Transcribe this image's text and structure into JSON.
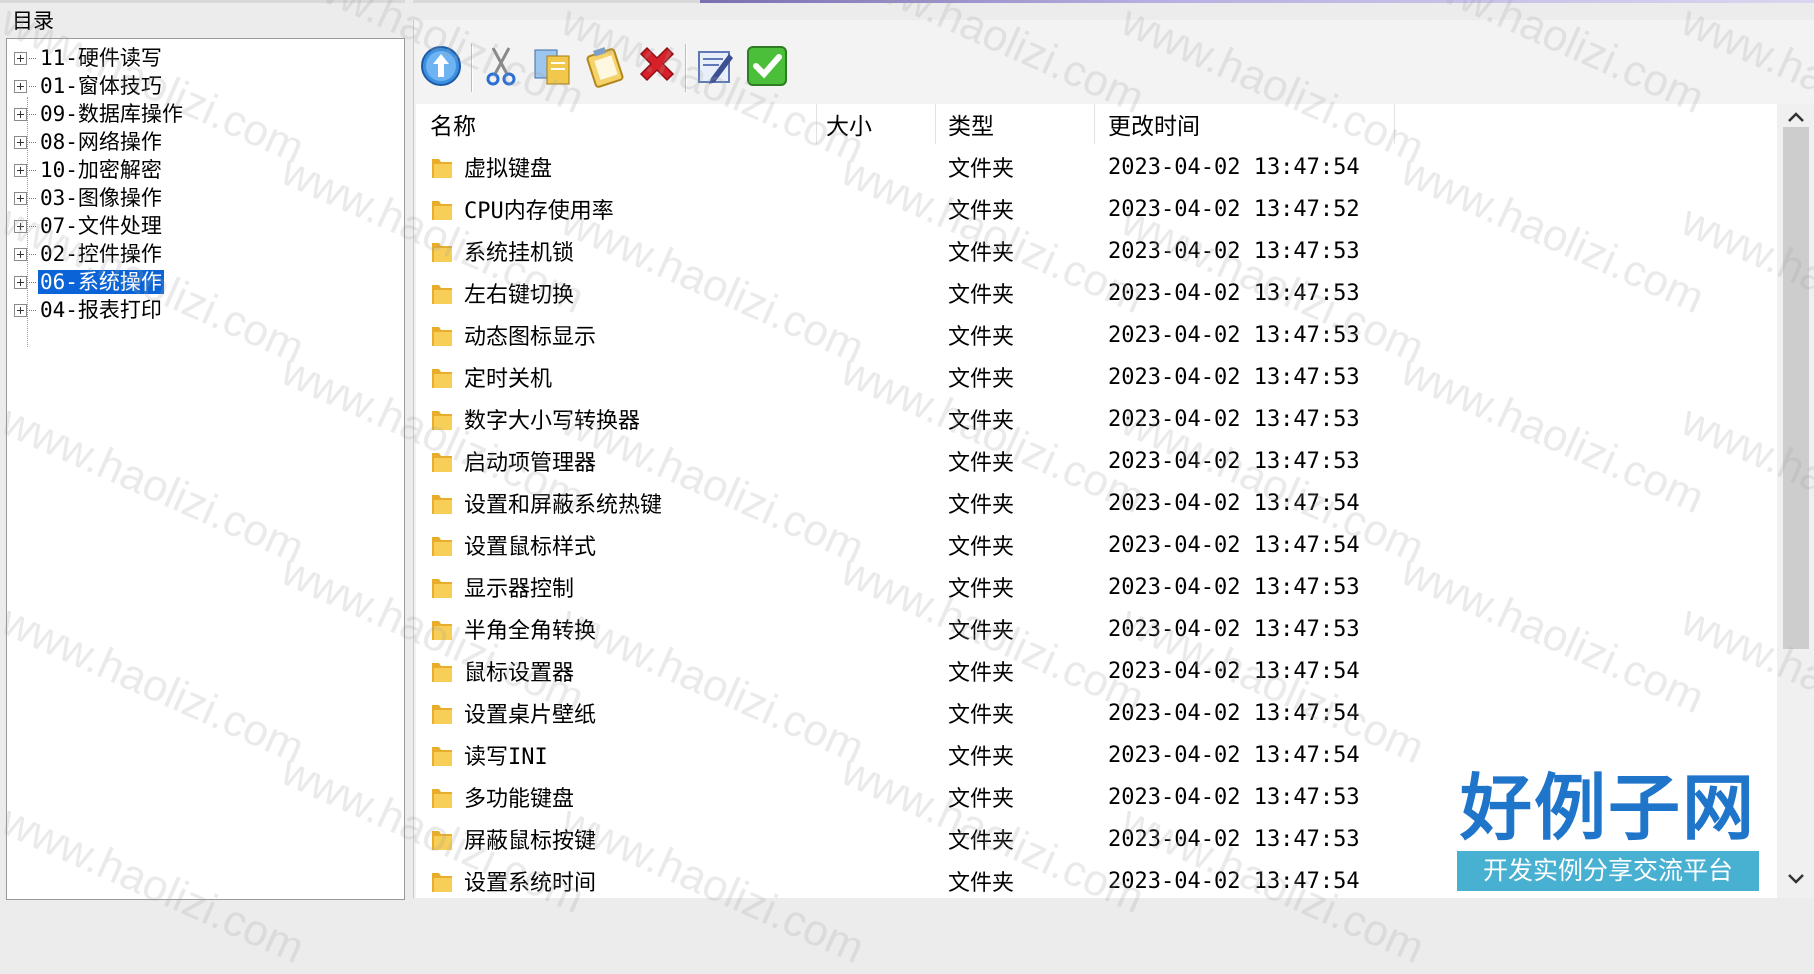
{
  "sidebar": {
    "title": "目录",
    "items": [
      {
        "label": "11-硬件读写",
        "selected": false
      },
      {
        "label": "01-窗体技巧",
        "selected": false
      },
      {
        "label": "09-数据库操作",
        "selected": false
      },
      {
        "label": "08-网络操作",
        "selected": false
      },
      {
        "label": "10-加密解密",
        "selected": false
      },
      {
        "label": "03-图像操作",
        "selected": false
      },
      {
        "label": "07-文件处理",
        "selected": false
      },
      {
        "label": "02-控件操作",
        "selected": false
      },
      {
        "label": "06-系统操作",
        "selected": true
      },
      {
        "label": "04-报表打印",
        "selected": false
      }
    ]
  },
  "toolbar": {
    "buttons": [
      {
        "name": "up-arrow-icon"
      },
      {
        "name": "scissors-icon"
      },
      {
        "name": "copy-icon"
      },
      {
        "name": "paste-icon"
      },
      {
        "name": "delete-icon"
      },
      {
        "name": "rename-icon"
      },
      {
        "name": "checkmark-icon"
      }
    ]
  },
  "list": {
    "headers": {
      "name": "名称",
      "size": "大小",
      "type": "类型",
      "modified": "更改时间"
    },
    "rows": [
      {
        "name": "虚拟键盘",
        "size": "",
        "type": "文件夹",
        "modified": "2023-04-02 13:47:54"
      },
      {
        "name": "CPU内存使用率",
        "size": "",
        "type": "文件夹",
        "modified": "2023-04-02 13:47:52"
      },
      {
        "name": "系统挂机锁",
        "size": "",
        "type": "文件夹",
        "modified": "2023-04-02 13:47:53"
      },
      {
        "name": "左右键切换",
        "size": "",
        "type": "文件夹",
        "modified": "2023-04-02 13:47:53"
      },
      {
        "name": "动态图标显示",
        "size": "",
        "type": "文件夹",
        "modified": "2023-04-02 13:47:53"
      },
      {
        "name": "定时关机",
        "size": "",
        "type": "文件夹",
        "modified": "2023-04-02 13:47:53"
      },
      {
        "name": "数字大小写转换器",
        "size": "",
        "type": "文件夹",
        "modified": "2023-04-02 13:47:53"
      },
      {
        "name": "启动项管理器",
        "size": "",
        "type": "文件夹",
        "modified": "2023-04-02 13:47:53"
      },
      {
        "name": "设置和屏蔽系统热键",
        "size": "",
        "type": "文件夹",
        "modified": "2023-04-02 13:47:54"
      },
      {
        "name": "设置鼠标样式",
        "size": "",
        "type": "文件夹",
        "modified": "2023-04-02 13:47:54"
      },
      {
        "name": "显示器控制",
        "size": "",
        "type": "文件夹",
        "modified": "2023-04-02 13:47:53"
      },
      {
        "name": "半角全角转换",
        "size": "",
        "type": "文件夹",
        "modified": "2023-04-02 13:47:53"
      },
      {
        "name": "鼠标设置器",
        "size": "",
        "type": "文件夹",
        "modified": "2023-04-02 13:47:54"
      },
      {
        "name": "设置桌片壁纸",
        "size": "",
        "type": "文件夹",
        "modified": "2023-04-02 13:47:54"
      },
      {
        "name": "读写INI",
        "size": "",
        "type": "文件夹",
        "modified": "2023-04-02 13:47:54"
      },
      {
        "name": "多功能键盘",
        "size": "",
        "type": "文件夹",
        "modified": "2023-04-02 13:47:53"
      },
      {
        "name": "屏蔽鼠标按键",
        "size": "",
        "type": "文件夹",
        "modified": "2023-04-02 13:47:53"
      },
      {
        "name": "设置系统时间",
        "size": "",
        "type": "文件夹",
        "modified": "2023-04-02 13:47:54"
      }
    ]
  },
  "watermark": {
    "text": "www.haolizi.com",
    "logo_title": "好例子网",
    "logo_subtitle": "开发实例分享交流平台"
  },
  "colors": {
    "selection": "#0a64d7",
    "folder": "#f4c542",
    "logo_blue": "#1f75c9"
  }
}
